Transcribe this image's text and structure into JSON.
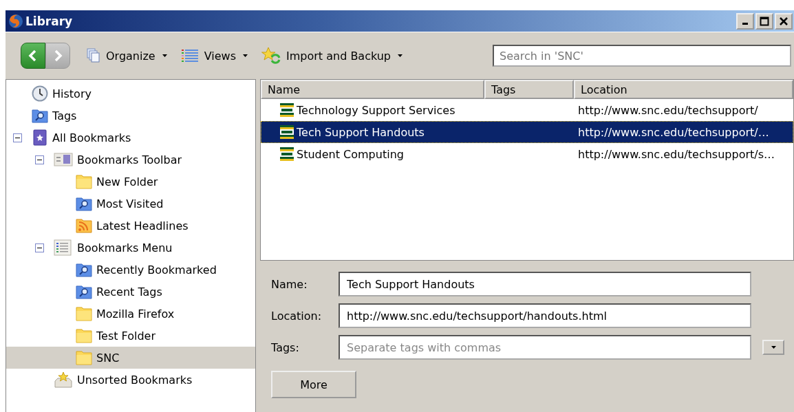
{
  "window": {
    "title": "Library"
  },
  "toolbar": {
    "back": {
      "disabled": false
    },
    "forward": {
      "disabled": true
    },
    "menus": [
      {
        "kind": "organize",
        "label": "Organize"
      },
      {
        "kind": "views",
        "label": "Views"
      },
      {
        "kind": "import",
        "label": "Import and Backup"
      }
    ],
    "search": {
      "placeholder": "Search in 'SNC'"
    }
  },
  "sidebar": {
    "items": [
      {
        "kind": "history",
        "label": "History",
        "selected": false
      },
      {
        "kind": "query",
        "label": "Tags",
        "selected": false
      },
      {
        "kind": "bookmarks",
        "label": "All Bookmarks",
        "selected": false,
        "expanded": true,
        "children": [
          {
            "kind": "toolbar",
            "label": "Bookmarks Toolbar",
            "selected": false,
            "expanded": true,
            "children": [
              {
                "kind": "folder",
                "label": "New Folder",
                "selected": false
              },
              {
                "kind": "query",
                "label": "Most Visited",
                "selected": false
              },
              {
                "kind": "feed",
                "label": "Latest Headlines",
                "selected": false
              }
            ]
          },
          {
            "kind": "menu",
            "label": "Bookmarks Menu",
            "selected": false,
            "expanded": true,
            "children": [
              {
                "kind": "query",
                "label": "Recently Bookmarked",
                "selected": false
              },
              {
                "kind": "query",
                "label": "Recent Tags",
                "selected": false
              },
              {
                "kind": "folder",
                "label": "Mozilla Firefox",
                "selected": false
              },
              {
                "kind": "folder",
                "label": "Test Folder",
                "selected": false
              },
              {
                "kind": "folder",
                "label": "SNC",
                "selected": true
              }
            ]
          },
          {
            "kind": "unsorted",
            "label": "Unsorted Bookmarks",
            "selected": false
          }
        ]
      }
    ]
  },
  "table": {
    "columns": [
      "Name",
      "Tags",
      "Location"
    ],
    "rows": [
      {
        "name": "Technology Support Services",
        "location": "http://www.snc.edu/techsupport/",
        "selected": false
      },
      {
        "name": "Tech Support Handouts",
        "location": "http://www.snc.edu/techsupport/…",
        "selected": true
      },
      {
        "name": "Student Computing",
        "location": "http://www.snc.edu/techsupport/s…",
        "selected": false
      }
    ]
  },
  "details": {
    "fields": [
      {
        "label": "Name:",
        "value": "Tech Support Handouts"
      },
      {
        "label": "Location:",
        "value": "http://www.snc.edu/techsupport/handouts.html"
      },
      {
        "label": "Tags:",
        "placeholder": "Separate tags with commas"
      }
    ],
    "more_button": {
      "label": "More"
    }
  }
}
